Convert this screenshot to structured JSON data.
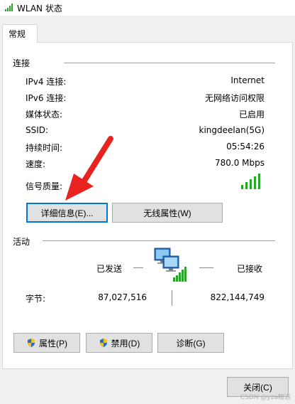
{
  "window": {
    "title": "WLAN 状态"
  },
  "tabs": [
    {
      "label": "常规"
    }
  ],
  "connection": {
    "group_label": "连接",
    "rows": [
      {
        "label": "IPv4 连接:",
        "value": "Internet"
      },
      {
        "label": "IPv6 连接:",
        "value": "无网络访问权限"
      },
      {
        "label": "媒体状态:",
        "value": "已启用"
      },
      {
        "label": "SSID:",
        "value": "kingdeelan(5G)"
      },
      {
        "label": "持续时间:",
        "value": "05:54:26"
      },
      {
        "label": "速度:",
        "value": "780.0 Mbps"
      }
    ],
    "signal_label": "信号质量:",
    "signal_bars": 5,
    "signal_bars_lit": 5
  },
  "buttons": {
    "details": "详细信息(E)...",
    "wireless_props": "无线属性(W)",
    "properties": "属性(P)",
    "disable": "禁用(D)",
    "diagnose": "诊断(G)",
    "close": "关闭(C)"
  },
  "activity": {
    "group_label": "活动",
    "sent_label": "已发送",
    "received_label": "已接收",
    "bytes_label": "字节:",
    "bytes_sent": "87,027,516",
    "bytes_received": "822,144,749"
  },
  "watermark": "CSDN @yza精选",
  "colors": {
    "signal": "#2aa52a",
    "arrow": "#e8231f",
    "focus": "#0078d7"
  }
}
